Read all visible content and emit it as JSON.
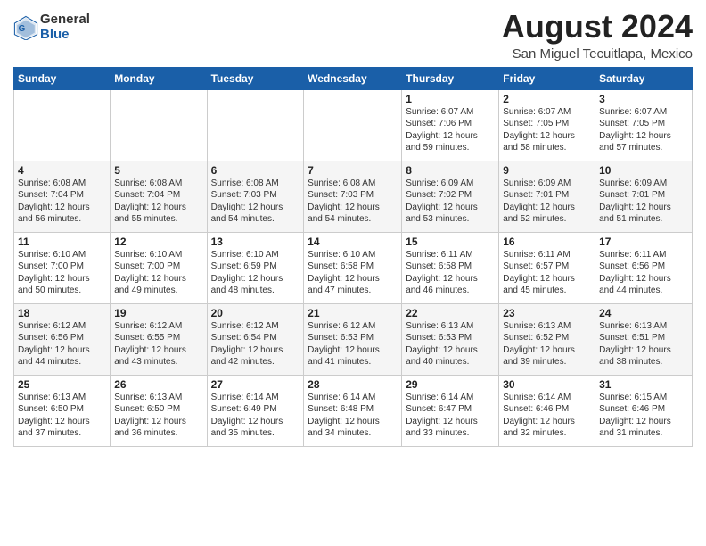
{
  "logo": {
    "general": "General",
    "blue": "Blue"
  },
  "title": "August 2024",
  "subtitle": "San Miguel Tecuitlapa, Mexico",
  "days_header": [
    "Sunday",
    "Monday",
    "Tuesday",
    "Wednesday",
    "Thursday",
    "Friday",
    "Saturday"
  ],
  "weeks": [
    [
      {
        "day": "",
        "info": ""
      },
      {
        "day": "",
        "info": ""
      },
      {
        "day": "",
        "info": ""
      },
      {
        "day": "",
        "info": ""
      },
      {
        "day": "1",
        "info": "Sunrise: 6:07 AM\nSunset: 7:06 PM\nDaylight: 12 hours\nand 59 minutes."
      },
      {
        "day": "2",
        "info": "Sunrise: 6:07 AM\nSunset: 7:05 PM\nDaylight: 12 hours\nand 58 minutes."
      },
      {
        "day": "3",
        "info": "Sunrise: 6:07 AM\nSunset: 7:05 PM\nDaylight: 12 hours\nand 57 minutes."
      }
    ],
    [
      {
        "day": "4",
        "info": "Sunrise: 6:08 AM\nSunset: 7:04 PM\nDaylight: 12 hours\nand 56 minutes."
      },
      {
        "day": "5",
        "info": "Sunrise: 6:08 AM\nSunset: 7:04 PM\nDaylight: 12 hours\nand 55 minutes."
      },
      {
        "day": "6",
        "info": "Sunrise: 6:08 AM\nSunset: 7:03 PM\nDaylight: 12 hours\nand 54 minutes."
      },
      {
        "day": "7",
        "info": "Sunrise: 6:08 AM\nSunset: 7:03 PM\nDaylight: 12 hours\nand 54 minutes."
      },
      {
        "day": "8",
        "info": "Sunrise: 6:09 AM\nSunset: 7:02 PM\nDaylight: 12 hours\nand 53 minutes."
      },
      {
        "day": "9",
        "info": "Sunrise: 6:09 AM\nSunset: 7:01 PM\nDaylight: 12 hours\nand 52 minutes."
      },
      {
        "day": "10",
        "info": "Sunrise: 6:09 AM\nSunset: 7:01 PM\nDaylight: 12 hours\nand 51 minutes."
      }
    ],
    [
      {
        "day": "11",
        "info": "Sunrise: 6:10 AM\nSunset: 7:00 PM\nDaylight: 12 hours\nand 50 minutes."
      },
      {
        "day": "12",
        "info": "Sunrise: 6:10 AM\nSunset: 7:00 PM\nDaylight: 12 hours\nand 49 minutes."
      },
      {
        "day": "13",
        "info": "Sunrise: 6:10 AM\nSunset: 6:59 PM\nDaylight: 12 hours\nand 48 minutes."
      },
      {
        "day": "14",
        "info": "Sunrise: 6:10 AM\nSunset: 6:58 PM\nDaylight: 12 hours\nand 47 minutes."
      },
      {
        "day": "15",
        "info": "Sunrise: 6:11 AM\nSunset: 6:58 PM\nDaylight: 12 hours\nand 46 minutes."
      },
      {
        "day": "16",
        "info": "Sunrise: 6:11 AM\nSunset: 6:57 PM\nDaylight: 12 hours\nand 45 minutes."
      },
      {
        "day": "17",
        "info": "Sunrise: 6:11 AM\nSunset: 6:56 PM\nDaylight: 12 hours\nand 44 minutes."
      }
    ],
    [
      {
        "day": "18",
        "info": "Sunrise: 6:12 AM\nSunset: 6:56 PM\nDaylight: 12 hours\nand 44 minutes."
      },
      {
        "day": "19",
        "info": "Sunrise: 6:12 AM\nSunset: 6:55 PM\nDaylight: 12 hours\nand 43 minutes."
      },
      {
        "day": "20",
        "info": "Sunrise: 6:12 AM\nSunset: 6:54 PM\nDaylight: 12 hours\nand 42 minutes."
      },
      {
        "day": "21",
        "info": "Sunrise: 6:12 AM\nSunset: 6:53 PM\nDaylight: 12 hours\nand 41 minutes."
      },
      {
        "day": "22",
        "info": "Sunrise: 6:13 AM\nSunset: 6:53 PM\nDaylight: 12 hours\nand 40 minutes."
      },
      {
        "day": "23",
        "info": "Sunrise: 6:13 AM\nSunset: 6:52 PM\nDaylight: 12 hours\nand 39 minutes."
      },
      {
        "day": "24",
        "info": "Sunrise: 6:13 AM\nSunset: 6:51 PM\nDaylight: 12 hours\nand 38 minutes."
      }
    ],
    [
      {
        "day": "25",
        "info": "Sunrise: 6:13 AM\nSunset: 6:50 PM\nDaylight: 12 hours\nand 37 minutes."
      },
      {
        "day": "26",
        "info": "Sunrise: 6:13 AM\nSunset: 6:50 PM\nDaylight: 12 hours\nand 36 minutes."
      },
      {
        "day": "27",
        "info": "Sunrise: 6:14 AM\nSunset: 6:49 PM\nDaylight: 12 hours\nand 35 minutes."
      },
      {
        "day": "28",
        "info": "Sunrise: 6:14 AM\nSunset: 6:48 PM\nDaylight: 12 hours\nand 34 minutes."
      },
      {
        "day": "29",
        "info": "Sunrise: 6:14 AM\nSunset: 6:47 PM\nDaylight: 12 hours\nand 33 minutes."
      },
      {
        "day": "30",
        "info": "Sunrise: 6:14 AM\nSunset: 6:46 PM\nDaylight: 12 hours\nand 32 minutes."
      },
      {
        "day": "31",
        "info": "Sunrise: 6:15 AM\nSunset: 6:46 PM\nDaylight: 12 hours\nand 31 minutes."
      }
    ]
  ]
}
